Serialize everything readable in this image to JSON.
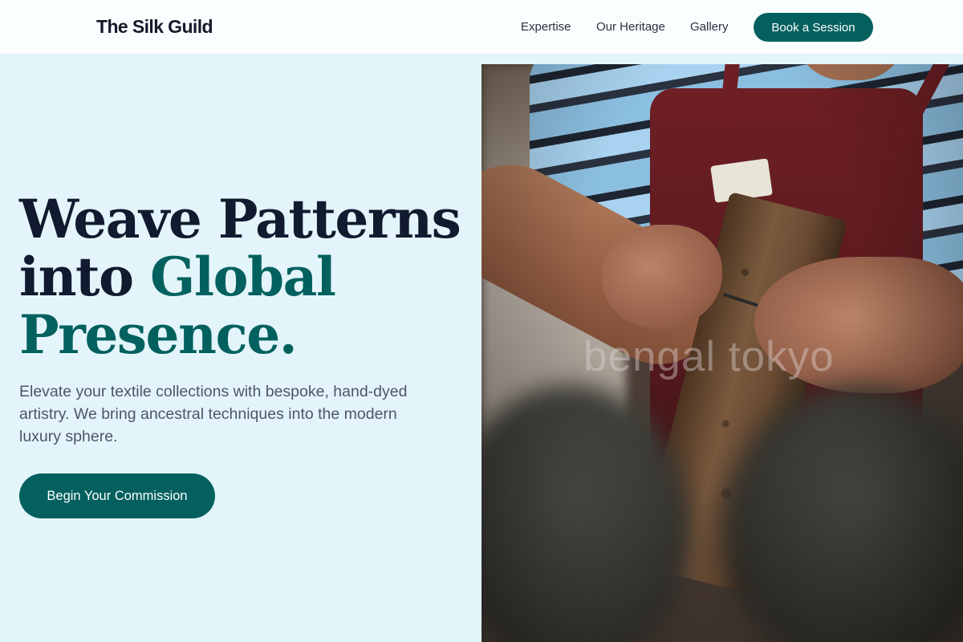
{
  "header": {
    "brand": "The Silk Guild",
    "nav": [
      {
        "label": "Expertise"
      },
      {
        "label": "Our Heritage"
      },
      {
        "label": "Gallery"
      }
    ],
    "cta_label": "Book a Session"
  },
  "hero": {
    "headline_line1": "Weave Patterns",
    "headline_line2_plain": "into ",
    "headline_line2_accent": "Global",
    "headline_line3_accent": "Presence.",
    "subtext": "Elevate your textile collections with bespoke, hand-dyed artistry. We bring ancestral techniques into the modern luxury sphere.",
    "cta_label": "Begin Your Commission",
    "image": {
      "watermark": "bengal tokyo"
    }
  },
  "colors": {
    "accent": "#03605f",
    "headline": "#111a2e",
    "background": "#e3f5fb",
    "body_text": "#4d5668"
  }
}
